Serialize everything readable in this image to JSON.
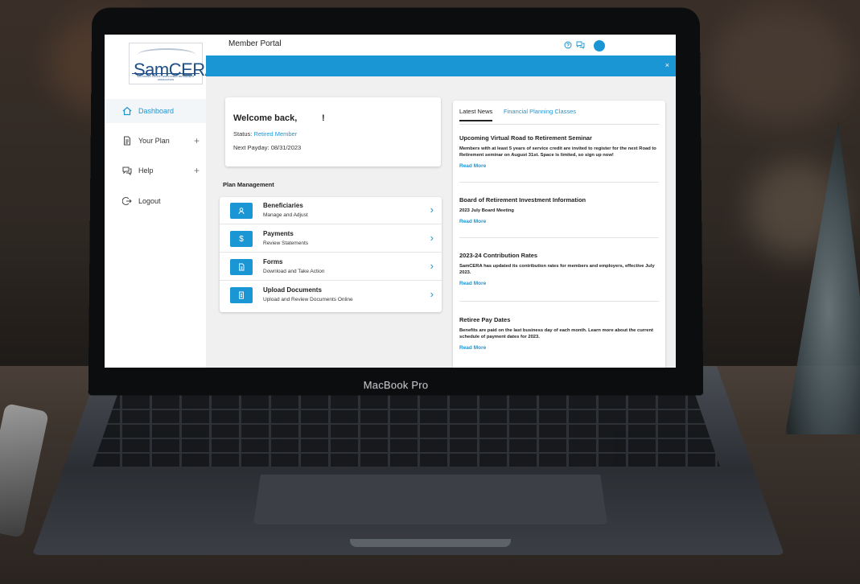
{
  "device": {
    "label": "MacBook Pro"
  },
  "logo": {
    "name": "SamCERA",
    "tagline": "SAN MATEO COUNTY EMPLOYEES' RETIREMENT ASSOCIATION"
  },
  "sidebar": {
    "items": [
      {
        "label": "Dashboard",
        "icon": "home-icon",
        "active": true
      },
      {
        "label": "Your Plan",
        "icon": "document-icon",
        "expandable": true
      },
      {
        "label": "Help",
        "icon": "chat-icon",
        "expandable": true
      },
      {
        "label": "Logout",
        "icon": "logout-icon"
      }
    ]
  },
  "topbar": {
    "title": "Member Portal",
    "icons": [
      "help-icon",
      "messages-icon",
      "avatar"
    ]
  },
  "banner": {
    "close": "×"
  },
  "welcome": {
    "title": "Welcome back,",
    "exclaim": "!",
    "status_label": "Status:",
    "status_value": "Retired Member",
    "next_payday": "Next Payday: 08/31/2023"
  },
  "plan_management": {
    "title": "Plan Management",
    "items": [
      {
        "name": "Beneficiaries",
        "sub": "Manage and Adjust",
        "icon": "person-icon"
      },
      {
        "name": "Payments",
        "sub": "Review Statements",
        "icon": "dollar-icon"
      },
      {
        "name": "Forms",
        "sub": "Download and Take Action",
        "icon": "form-icon"
      },
      {
        "name": "Upload Documents",
        "sub": "Upload and Review Documents Online",
        "icon": "upload-document-icon"
      }
    ]
  },
  "news": {
    "tabs": [
      "Latest News",
      "Financial Planning Classes"
    ],
    "items": [
      {
        "title": "Upcoming Virtual Road to Retirement Seminar",
        "body": "Members with at least 5 years of service credit are invited to register for the next Road to Retirement seminar on August 31st. Space is limited, so sign up now!",
        "link": "Read More"
      },
      {
        "title": "Board of Retirement Investment Information",
        "body": "2023 July Board Meeting",
        "link": "Read More"
      },
      {
        "title": "2023-24 Contribution Rates",
        "body": "SamCERA has updated its contribution rates for members and employers, effective July 2023.",
        "link": "Read More"
      },
      {
        "title": "Retiree Pay Dates",
        "body": "Benefits are paid on the last business day of each month. Learn more about the current schedule of payment dates for 2023.",
        "link": "Read More"
      }
    ]
  },
  "colors": {
    "accent": "#1a96d4",
    "brand": "#1d4f86"
  }
}
